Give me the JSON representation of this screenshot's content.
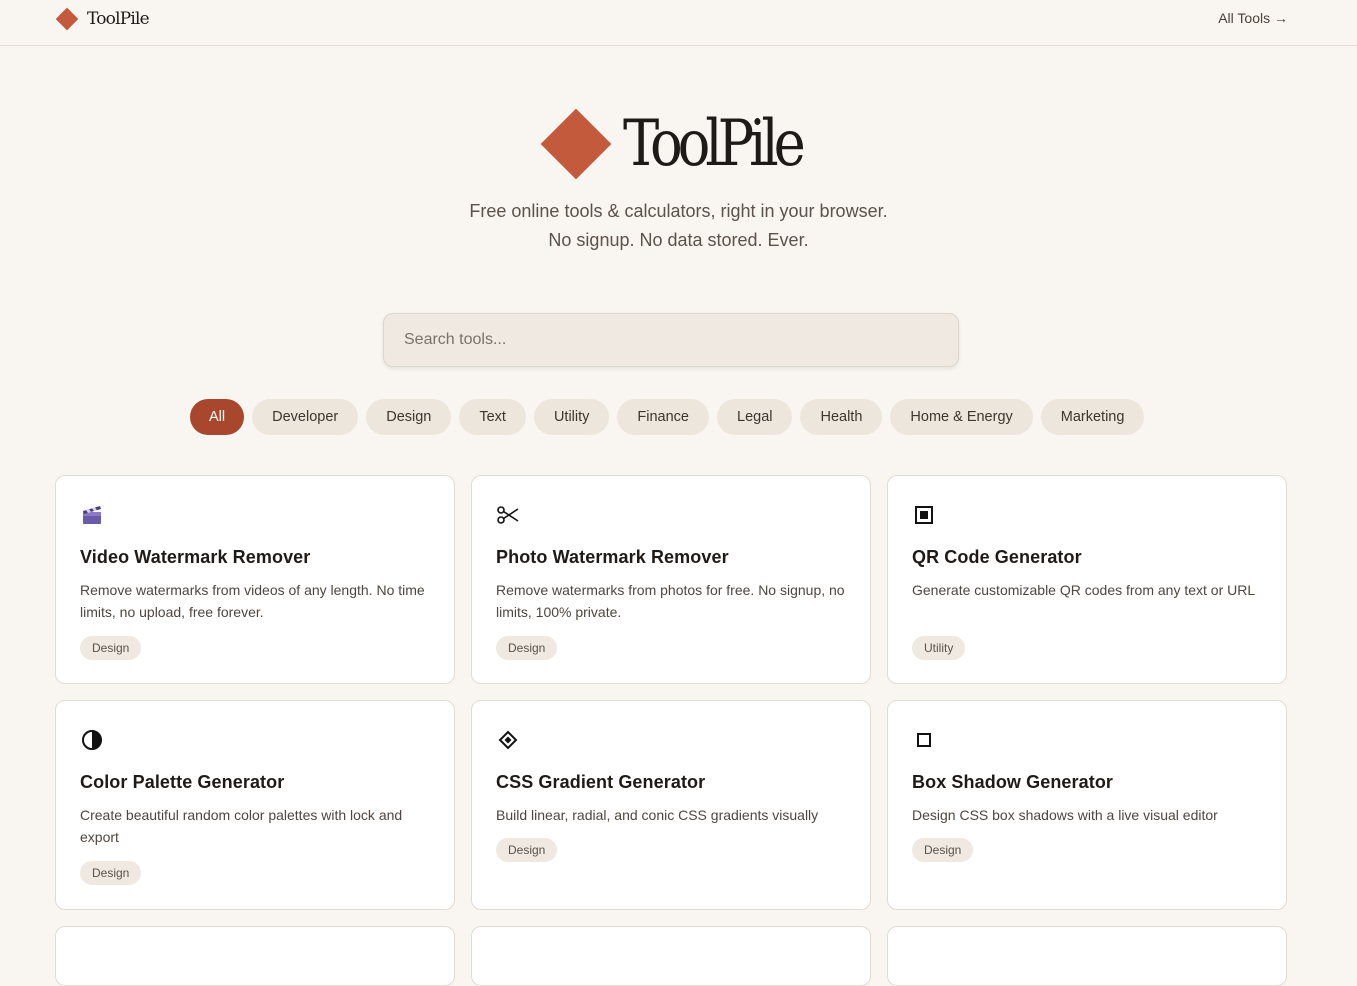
{
  "nav": {
    "brand": "ToolPile",
    "all_tools": "All Tools →"
  },
  "hero": {
    "title": "ToolPile",
    "tagline_1": "Free online tools & calculators, right in your browser.",
    "tagline_2": "No signup. No data stored. Ever."
  },
  "search": {
    "placeholder": "Search tools..."
  },
  "filters": [
    "All",
    "Developer",
    "Design",
    "Text",
    "Utility",
    "Finance",
    "Legal",
    "Health",
    "Home & Energy",
    "Marketing"
  ],
  "active_filter": "All",
  "colors": {
    "accent": "#c45a3c",
    "active_chip": "#a8472e",
    "background": "#f9f6f1"
  },
  "cards": [
    {
      "icon": "clapperboard-icon",
      "title": "Video Watermark Remover",
      "description": "Remove watermarks from videos of any length. No time limits, no upload, free forever.",
      "tag": "Design"
    },
    {
      "icon": "scissors-icon",
      "title": "Photo Watermark Remover",
      "description": "Remove watermarks from photos for free. No signup, no limits, 100% private.",
      "tag": "Design"
    },
    {
      "icon": "qr-square-icon",
      "title": "QR Code Generator",
      "description": "Generate customizable QR codes from any text or URL",
      "tag": "Utility"
    },
    {
      "icon": "half-circle-icon",
      "title": "Color Palette Generator",
      "description": "Create beautiful random color palettes with lock and export",
      "tag": "Design"
    },
    {
      "icon": "diamond-dot-icon",
      "title": "CSS Gradient Generator",
      "description": "Build linear, radial, and conic CSS gradients visually",
      "tag": "Design"
    },
    {
      "icon": "square-outline-icon",
      "title": "Box Shadow Generator",
      "description": "Design CSS box shadows with a live visual editor",
      "tag": "Design"
    }
  ]
}
